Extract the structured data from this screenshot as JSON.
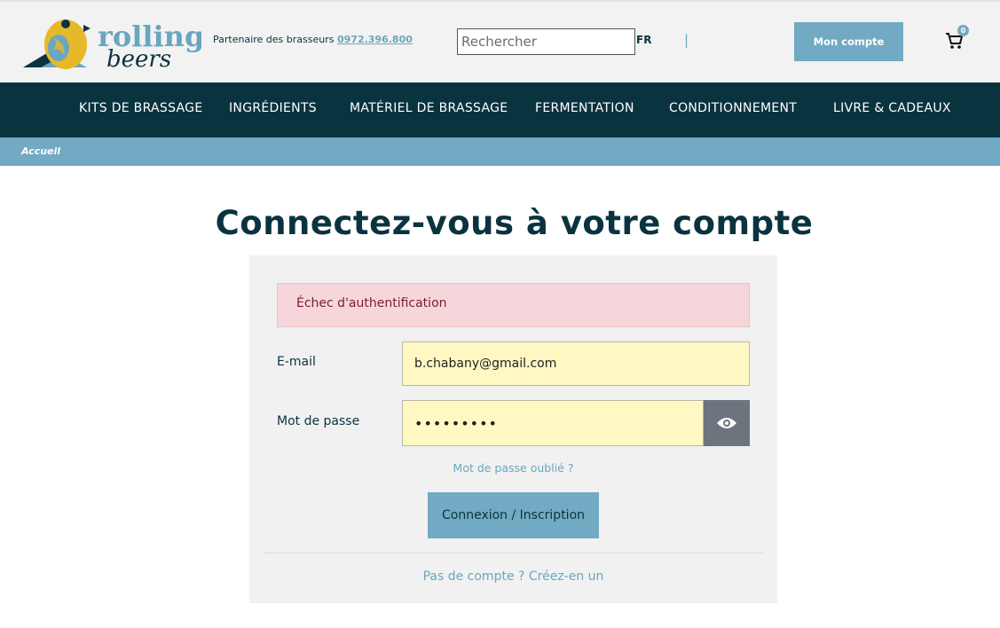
{
  "header": {
    "brand_line1": "rolling",
    "brand_line2": "beers",
    "partner_text": "Partenaire des brasseurs",
    "partner_phone": "0972.396.800",
    "search_placeholder": "Rechercher",
    "lang": "FR",
    "separator": "|",
    "account_label": "Mon compte",
    "cart_count": "0"
  },
  "nav": {
    "items": [
      {
        "label": "KITS DE BRASSAGE"
      },
      {
        "label": "INGRÉDIENTS"
      },
      {
        "label": "MATÉRIEL DE BRASSAGE"
      },
      {
        "label": "FERMENTATION"
      },
      {
        "label": "CONDITIONNEMENT"
      },
      {
        "label": "LIVRE & CADEAUX"
      }
    ]
  },
  "breadcrumb": {
    "home": "Accueil"
  },
  "login": {
    "title": "Connectez-vous à votre compte",
    "alert": "Échec d'authentification",
    "email_label": "E-mail",
    "email_value": "b.chabany@gmail.com",
    "password_label": "Mot de passe",
    "password_value": "•••••••••",
    "forgot_label": "Mot de passe oublié ?",
    "submit_label": "Connexion / Inscription",
    "create_label": "Pas de compte ? Créez-en un"
  },
  "colors": {
    "navy": "#0a3340",
    "accent": "#72aac3",
    "alert_bg": "#f6d6da",
    "field_bg": "#fff8c3",
    "logo_yellow": "#e7b928"
  }
}
